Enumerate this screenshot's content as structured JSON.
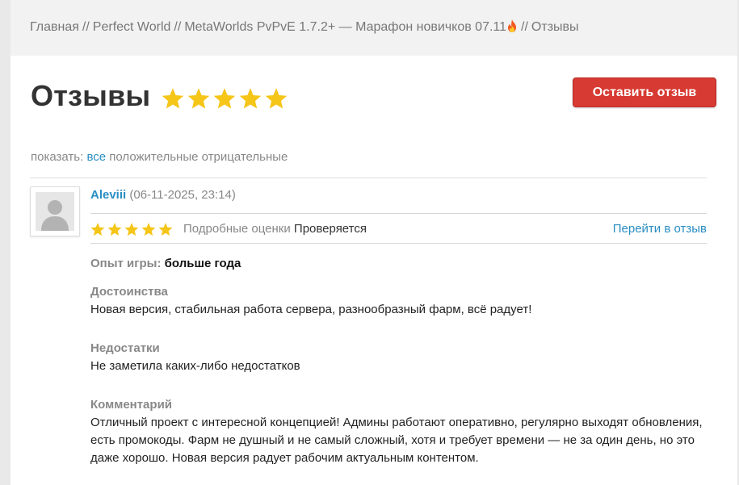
{
  "breadcrumb": {
    "items": [
      "Главная",
      "Perfect World",
      "MetaWorlds PvPvE 1.7.2+ — Марафон новичков 07.11",
      "Отзывы"
    ],
    "separator": "//",
    "fire_icon": "fire-emoji"
  },
  "header": {
    "title": "Отзывы",
    "rating_stars": 5,
    "button_label": "Оставить отзыв"
  },
  "filter": {
    "label": "показать:",
    "options": [
      "все",
      "положительные",
      "отрицательные"
    ],
    "active": "все"
  },
  "review": {
    "author": "Aleviii",
    "date": "(06-11-2025, 23:14)",
    "stars": 5,
    "detailed_label": "Подробные оценки",
    "status": "Проверяется",
    "goto_link": "Перейти в отзыв",
    "experience_label": "Опыт игры:",
    "experience_value": "больше года",
    "pros_label": "Достоинства",
    "pros_text": "Новая версия, стабильная работа сервера, разнообразный фарм, всё радует!",
    "cons_label": "Недостатки",
    "cons_text": "Не заметила каких-либо недостатков",
    "comment_label": "Комментарий",
    "comment_text": "Отличный проект с интересной концепцией! Админы работают оперативно, регулярно выходят обновления, есть промокоды. Фарм не душный и не самый сложный, хотя и требует времени — не за один день, но это даже хорошо. Новая версия радует рабочим актуальным контентом."
  },
  "colors": {
    "accent_link": "#2a8ec2",
    "button_red": "#d73a32",
    "star_gold": "#f5c518"
  }
}
